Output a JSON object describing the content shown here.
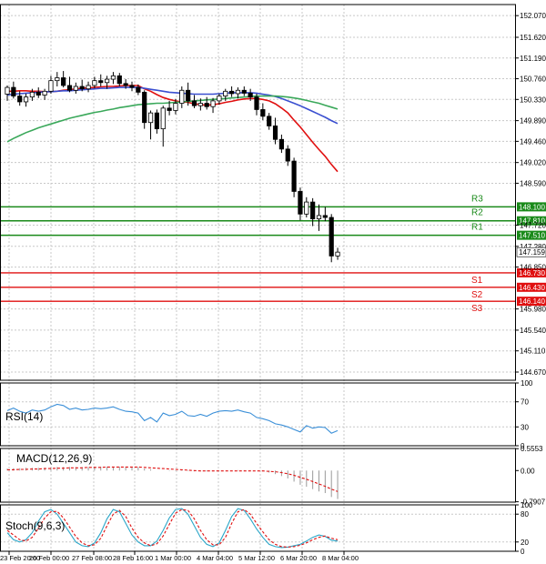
{
  "chart_data": [
    {
      "type": "candlestick",
      "panel": "price",
      "ylim": [
        144.5,
        152.3
      ],
      "y_ticks": [
        "152.070",
        "151.620",
        "151.190",
        "150.760",
        "150.330",
        "149.890",
        "149.460",
        "149.020",
        "148.590",
        "147.720",
        "147.280",
        "146.850",
        "145.980",
        "145.540",
        "145.110",
        "144.670"
      ],
      "current_price": "147.159",
      "levels": [
        {
          "name": "R3",
          "value": "148.100",
          "color": "#1a8a1a"
        },
        {
          "name": "R2",
          "value": "147.810",
          "color": "#1a8a1a"
        },
        {
          "name": "R1",
          "value": "147.510",
          "color": "#1a8a1a"
        },
        {
          "name": "S1",
          "value": "146.730",
          "color": "#e01010"
        },
        {
          "name": "S2",
          "value": "146.430",
          "color": "#e01010"
        },
        {
          "name": "S3",
          "value": "146.140",
          "color": "#e01010"
        }
      ],
      "ohlc": [
        [
          150.44,
          150.62,
          150.3,
          150.58
        ],
        [
          150.58,
          150.7,
          150.35,
          150.4
        ],
        [
          150.4,
          150.5,
          150.2,
          150.28
        ],
        [
          150.28,
          150.45,
          150.18,
          150.38
        ],
        [
          150.38,
          150.55,
          150.3,
          150.48
        ],
        [
          150.48,
          150.58,
          150.36,
          150.42
        ],
        [
          150.42,
          150.55,
          150.32,
          150.5
        ],
        [
          150.5,
          150.82,
          150.45,
          150.72
        ],
        [
          150.72,
          150.9,
          150.6,
          150.78
        ],
        [
          150.78,
          150.92,
          150.58,
          150.62
        ],
        [
          150.62,
          150.8,
          150.48,
          150.52
        ],
        [
          150.52,
          150.68,
          150.45,
          150.6
        ],
        [
          150.6,
          150.74,
          150.5,
          150.55
        ],
        [
          150.55,
          150.7,
          150.48,
          150.62
        ],
        [
          150.62,
          150.8,
          150.56,
          150.72
        ],
        [
          150.72,
          150.85,
          150.6,
          150.68
        ],
        [
          150.68,
          150.82,
          150.55,
          150.75
        ],
        [
          150.75,
          150.9,
          150.65,
          150.82
        ],
        [
          150.82,
          150.88,
          150.6,
          150.66
        ],
        [
          150.66,
          150.75,
          150.55,
          150.62
        ],
        [
          150.62,
          150.7,
          150.5,
          150.58
        ],
        [
          150.58,
          150.64,
          150.42,
          150.48
        ],
        [
          150.48,
          150.52,
          149.72,
          149.85
        ],
        [
          149.85,
          150.1,
          149.5,
          150.05
        ],
        [
          150.05,
          150.12,
          149.62,
          149.72
        ],
        [
          149.72,
          150.2,
          149.35,
          150.15
        ],
        [
          150.15,
          150.3,
          150.0,
          150.1
        ],
        [
          150.1,
          150.34,
          150.02,
          150.25
        ],
        [
          150.25,
          150.6,
          150.15,
          150.52
        ],
        [
          150.52,
          150.68,
          150.2,
          150.3
        ],
        [
          150.3,
          150.42,
          150.15,
          150.2
        ],
        [
          150.2,
          150.35,
          150.1,
          150.25
        ],
        [
          150.25,
          150.38,
          150.12,
          150.18
        ],
        [
          150.18,
          150.36,
          150.05,
          150.3
        ],
        [
          150.3,
          150.45,
          150.22,
          150.4
        ],
        [
          150.4,
          150.55,
          150.3,
          150.5
        ],
        [
          150.5,
          150.6,
          150.38,
          150.45
        ],
        [
          150.45,
          150.58,
          150.35,
          150.52
        ],
        [
          150.52,
          150.6,
          150.4,
          150.46
        ],
        [
          150.46,
          150.55,
          150.3,
          150.38
        ],
        [
          150.38,
          150.45,
          150.0,
          150.12
        ],
        [
          150.12,
          150.25,
          149.9,
          149.98
        ],
        [
          149.98,
          150.05,
          149.7,
          149.78
        ],
        [
          149.78,
          149.95,
          149.4,
          149.5
        ],
        [
          149.5,
          149.6,
          149.22,
          149.3
        ],
        [
          149.3,
          149.38,
          148.95,
          149.05
        ],
        [
          149.05,
          149.12,
          148.3,
          148.42
        ],
        [
          148.42,
          148.5,
          147.82,
          147.95
        ],
        [
          147.95,
          148.3,
          147.88,
          148.2
        ],
        [
          148.2,
          148.28,
          147.7,
          147.85
        ],
        [
          147.85,
          148.15,
          147.6,
          147.92
        ],
        [
          147.92,
          148.1,
          147.8,
          147.88
        ],
        [
          147.88,
          147.95,
          146.95,
          147.08
        ],
        [
          147.08,
          147.25,
          147.0,
          147.16
        ]
      ],
      "moving_averages": [
        {
          "color": "#e01010",
          "values": [
            150.5,
            150.5,
            150.51,
            150.51,
            150.5,
            150.5,
            150.49,
            150.49,
            150.5,
            150.52,
            150.53,
            150.55,
            150.56,
            150.57,
            150.58,
            150.59,
            150.6,
            150.6,
            150.61,
            150.62,
            150.62,
            150.62,
            150.55,
            150.5,
            150.43,
            150.37,
            150.33,
            150.3,
            150.28,
            150.27,
            150.24,
            150.22,
            150.21,
            150.22,
            150.24,
            150.27,
            150.29,
            150.32,
            150.34,
            150.35,
            150.35,
            150.33,
            150.3,
            150.24,
            150.15,
            150.05,
            149.9,
            149.76,
            149.6,
            149.44,
            149.29,
            149.15,
            148.98,
            148.83
          ]
        },
        {
          "color": "#3a4fd0",
          "values": [
            150.42,
            150.44,
            150.45,
            150.46,
            150.47,
            150.48,
            150.49,
            150.49,
            150.5,
            150.51,
            150.51,
            150.52,
            150.53,
            150.54,
            150.55,
            150.56,
            150.56,
            150.57,
            150.58,
            150.58,
            150.58,
            150.58,
            150.56,
            150.54,
            150.52,
            150.5,
            150.48,
            150.47,
            150.46,
            150.45,
            150.44,
            150.44,
            150.44,
            150.44,
            150.45,
            150.46,
            150.47,
            150.47,
            150.47,
            150.47,
            150.46,
            150.44,
            150.42,
            150.39,
            150.35,
            150.3,
            150.25,
            150.2,
            150.14,
            150.08,
            150.02,
            149.96,
            149.89,
            149.83
          ]
        },
        {
          "color": "#3aa85a",
          "values": [
            149.45,
            149.52,
            149.58,
            149.64,
            149.69,
            149.74,
            149.78,
            149.82,
            149.86,
            149.9,
            149.94,
            149.97,
            150.0,
            150.03,
            150.06,
            150.08,
            150.11,
            150.13,
            150.16,
            150.18,
            150.2,
            150.22,
            150.23,
            150.24,
            150.25,
            150.25,
            150.26,
            150.27,
            150.28,
            150.29,
            150.3,
            150.31,
            150.32,
            150.33,
            150.34,
            150.35,
            150.36,
            150.37,
            150.38,
            150.39,
            150.4,
            150.4,
            150.4,
            150.4,
            150.39,
            150.38,
            150.36,
            150.34,
            150.31,
            150.28,
            150.25,
            150.21,
            150.17,
            150.13
          ]
        }
      ]
    },
    {
      "type": "line",
      "panel": "rsi",
      "label": "RSI(14)",
      "ylim": [
        0,
        100
      ],
      "y_ticks": [
        "100",
        "70",
        "30",
        "0"
      ],
      "series": [
        {
          "color": "#3a8fd8",
          "values": [
            56,
            60,
            55,
            52,
            57,
            55,
            57,
            62,
            66,
            64,
            58,
            60,
            57,
            58,
            60,
            59,
            60,
            62,
            58,
            55,
            54,
            52,
            40,
            45,
            38,
            52,
            48,
            50,
            55,
            48,
            47,
            50,
            47,
            52,
            55,
            56,
            55,
            57,
            54,
            52,
            45,
            43,
            40,
            35,
            33,
            30,
            26,
            22,
            32,
            28,
            30,
            29,
            20,
            24
          ]
        }
      ]
    },
    {
      "type": "bar+line",
      "panel": "macd",
      "label": "MACD(12,26,9)",
      "ylim": [
        -0.8,
        0.56
      ],
      "y_ticks": [
        "0.5553",
        "0.00",
        "-0.7907"
      ],
      "histogram": [
        0.05,
        0.06,
        0.06,
        0.07,
        0.07,
        0.07,
        0.07,
        0.08,
        0.09,
        0.09,
        0.09,
        0.09,
        0.09,
        0.09,
        0.1,
        0.1,
        0.1,
        0.1,
        0.1,
        0.1,
        0.09,
        0.09,
        0.05,
        0.03,
        0.0,
        0.0,
        -0.01,
        -0.01,
        -0.01,
        -0.01,
        -0.02,
        -0.02,
        -0.02,
        -0.02,
        -0.01,
        0.0,
        0.0,
        0.01,
        0.01,
        0.01,
        0.0,
        -0.02,
        -0.05,
        -0.09,
        -0.14,
        -0.2,
        -0.28,
        -0.36,
        -0.41,
        -0.47,
        -0.53,
        -0.57,
        -0.67,
        -0.72
      ],
      "signal": [
        0.02,
        0.02,
        0.03,
        0.03,
        0.04,
        0.04,
        0.05,
        0.05,
        0.06,
        0.06,
        0.07,
        0.07,
        0.07,
        0.08,
        0.08,
        0.08,
        0.09,
        0.09,
        0.09,
        0.09,
        0.09,
        0.09,
        0.08,
        0.07,
        0.06,
        0.05,
        0.04,
        0.03,
        0.02,
        0.01,
        0.0,
        -0.01,
        -0.01,
        -0.01,
        -0.01,
        -0.01,
        -0.01,
        -0.01,
        -0.01,
        -0.01,
        -0.01,
        -0.01,
        -0.02,
        -0.03,
        -0.05,
        -0.08,
        -0.12,
        -0.17,
        -0.22,
        -0.28,
        -0.34,
        -0.4,
        -0.47,
        -0.53
      ],
      "signal_color": "#e01010",
      "hist_color": "#999999"
    },
    {
      "type": "line",
      "panel": "stoch",
      "label": "Stoch(9,6,3)",
      "ylim": [
        0,
        100
      ],
      "y_ticks": [
        "100",
        "80",
        "20",
        "0"
      ],
      "series": [
        {
          "color": "#2aa6c8",
          "values": [
            40,
            25,
            20,
            25,
            40,
            65,
            85,
            90,
            80,
            60,
            40,
            20,
            12,
            10,
            18,
            40,
            70,
            90,
            85,
            60,
            35,
            20,
            12,
            12,
            22,
            45,
            72,
            90,
            92,
            80,
            55,
            30,
            15,
            10,
            18,
            45,
            75,
            92,
            88,
            70,
            48,
            30,
            15,
            10,
            8,
            9,
            12,
            15,
            22,
            30,
            35,
            32,
            24,
            22
          ]
        },
        {
          "color": "#e01010",
          "values": [
            45,
            35,
            25,
            22,
            30,
            50,
            72,
            85,
            86,
            72,
            52,
            32,
            18,
            12,
            14,
            28,
            55,
            80,
            88,
            75,
            50,
            30,
            18,
            12,
            16,
            33,
            58,
            82,
            90,
            88,
            70,
            45,
            25,
            14,
            14,
            30,
            60,
            85,
            90,
            80,
            60,
            42,
            25,
            15,
            10,
            9,
            10,
            13,
            18,
            25,
            30,
            33,
            28,
            25
          ]
        }
      ]
    }
  ],
  "x_axis": {
    "tick_labels": [
      "23 Feb 20:00",
      "26 Feb 00:00",
      "27 Feb 08:00",
      "28 Feb 16:00",
      "1 Mar 00:00",
      "4 Mar 04:00",
      "5 Mar 12:00",
      "6 Mar 20:00",
      "8 Mar 04:00"
    ]
  },
  "labels": {
    "rsi": "RSI(14)",
    "macd": "MACD(12,26,9)",
    "stoch": "Stoch(9,6,3)"
  }
}
